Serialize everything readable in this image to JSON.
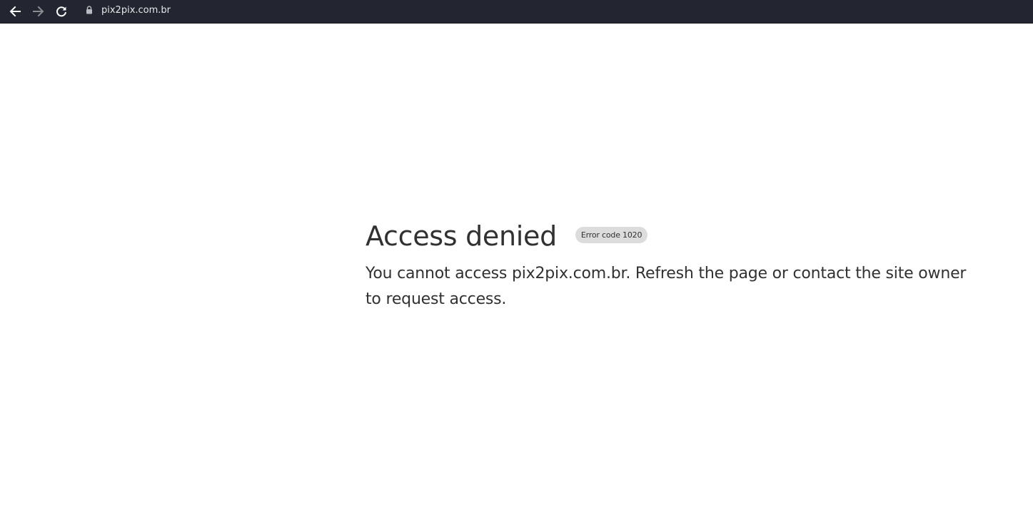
{
  "browser": {
    "url": "pix2pix.com.br",
    "icons": {
      "back": "arrow-left-icon",
      "forward": "arrow-right-icon",
      "reload": "reload-icon",
      "lock": "lock-icon"
    },
    "colors": {
      "toolbar_bg": "#232630",
      "icon_active": "#ffffff",
      "icon_disabled": "#8a8c92"
    }
  },
  "page": {
    "title": "Access denied",
    "error_badge": "Error code 1020",
    "message": "You cannot access pix2pix.com.br. Refresh the page or contact the site owner to request access.",
    "colors": {
      "text": "#313131",
      "badge_bg": "#dcdcdc",
      "background": "#ffffff"
    }
  }
}
